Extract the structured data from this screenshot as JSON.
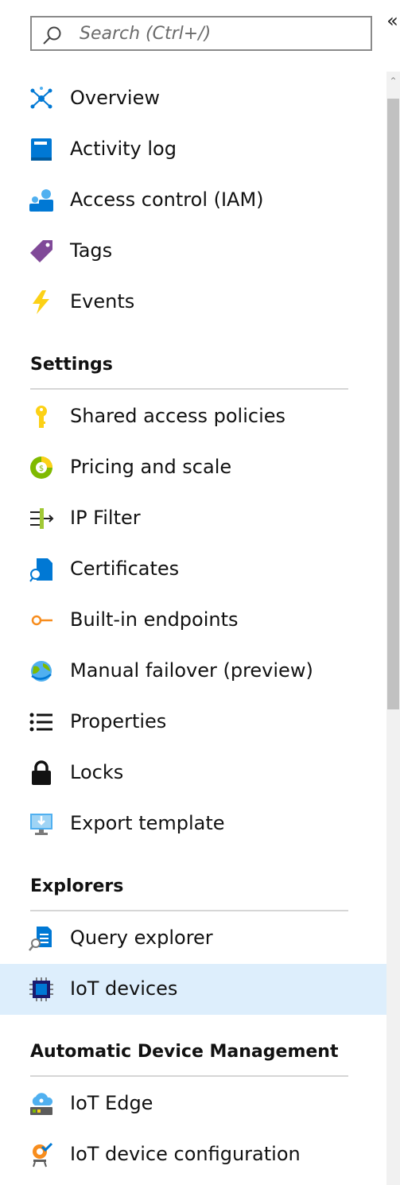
{
  "collapse": {
    "glyph": "«"
  },
  "search": {
    "placeholder": "Search (Ctrl+/)"
  },
  "menu": {
    "overview": "Overview",
    "activity_log": "Activity log",
    "access_control": "Access control (IAM)",
    "tags": "Tags",
    "events": "Events"
  },
  "settings": {
    "title": "Settings",
    "shared_access": "Shared access policies",
    "pricing": "Pricing and scale",
    "ip_filter": "IP Filter",
    "certificates": "Certificates",
    "endpoints": "Built-in endpoints",
    "failover": "Manual failover (preview)",
    "properties": "Properties",
    "locks": "Locks",
    "export": "Export template"
  },
  "explorers": {
    "title": "Explorers",
    "query": "Query explorer",
    "iot_devices": "IoT devices"
  },
  "adm": {
    "title": "Automatic Device Management",
    "iot_edge": "IoT Edge",
    "iot_config": "IoT device configuration"
  },
  "colors": {
    "selected_bg": "#ddeefc",
    "azure_blue": "#0078d4",
    "rule": "#d6d6d6"
  }
}
